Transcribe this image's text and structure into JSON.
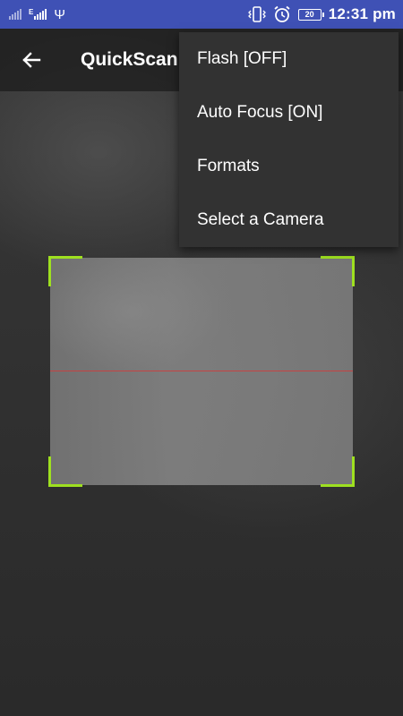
{
  "status_bar": {
    "network_type": "E",
    "battery_level": "20",
    "time": "12:31 pm",
    "icons": [
      "signal-icon",
      "signal-icon",
      "usb-icon",
      "vibrate-icon",
      "alarm-icon",
      "battery-icon"
    ]
  },
  "app_bar": {
    "title": "QuickScan",
    "back_icon": "arrow-back-icon"
  },
  "menu": {
    "items": [
      {
        "label": "Flash [OFF]"
      },
      {
        "label": "Auto Focus [ON]"
      },
      {
        "label": "Formats"
      },
      {
        "label": "Select a Camera"
      }
    ]
  },
  "colors": {
    "status_bar": "#3f51b5",
    "scan_frame": "#9ee020",
    "laser": "#d33a3a",
    "menu_bg": "#323232"
  }
}
